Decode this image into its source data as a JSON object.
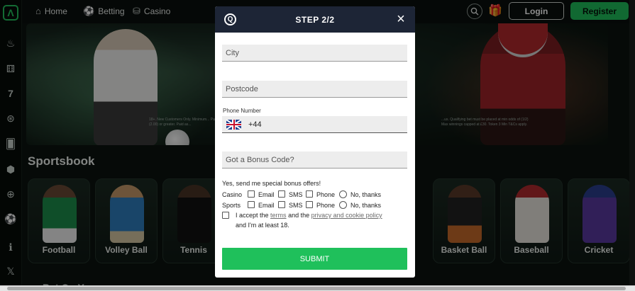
{
  "nav": {
    "home": "Home",
    "betting": "Betting",
    "casino": "Casino",
    "login": "Login",
    "register": "Register",
    "brand_color": "#1fc05b"
  },
  "sidebar_icons": [
    "logo-icon",
    "fire-icon",
    "dice-icon",
    "seven-icon",
    "roulette-icon",
    "cards-icon",
    "dice2-icon",
    "chip-icon",
    "soccer-icon",
    "info-icon",
    "x-icon"
  ],
  "hero": {
    "fine_left": "18+. New Customers Only. Minimum... Paid as ... (2.00) or greater. Paid as...",
    "fine_right": "...us. Qualifying bet must be placed at min odds of (1/2) Max winnings capped at £30. Token 3 Min T&Cs apply."
  },
  "sportsbook": {
    "title": "Sportsbook",
    "tiles": [
      {
        "label": "Football"
      },
      {
        "label": "Volley Ball"
      },
      {
        "label": "Tennis"
      },
      {
        "label": "Basket Ball"
      },
      {
        "label": "Baseball"
      },
      {
        "label": "Cricket"
      }
    ],
    "next_section": "Bet On Your..."
  },
  "modal": {
    "title": "STEP 2/2",
    "city_placeholder": "City",
    "postcode_placeholder": "Postcode",
    "phone_label": "Phone Number",
    "phone_code": "+44",
    "bonus_placeholder": "Got a Bonus Code?",
    "offers_text": "Yes, send me special bonus offers!",
    "casino_label": "Casino",
    "sports_label": "Sports",
    "opt_email": "Email",
    "opt_sms": "SMS",
    "opt_phone": "Phone",
    "opt_no": "No, thanks",
    "accept_prefix": "I accept the",
    "terms_link": "terms",
    "accept_mid": "and the",
    "privacy_link": "privacy and cookie policy",
    "accept_suffix": "and I'm at least 18.",
    "submit": "SUBMIT"
  }
}
